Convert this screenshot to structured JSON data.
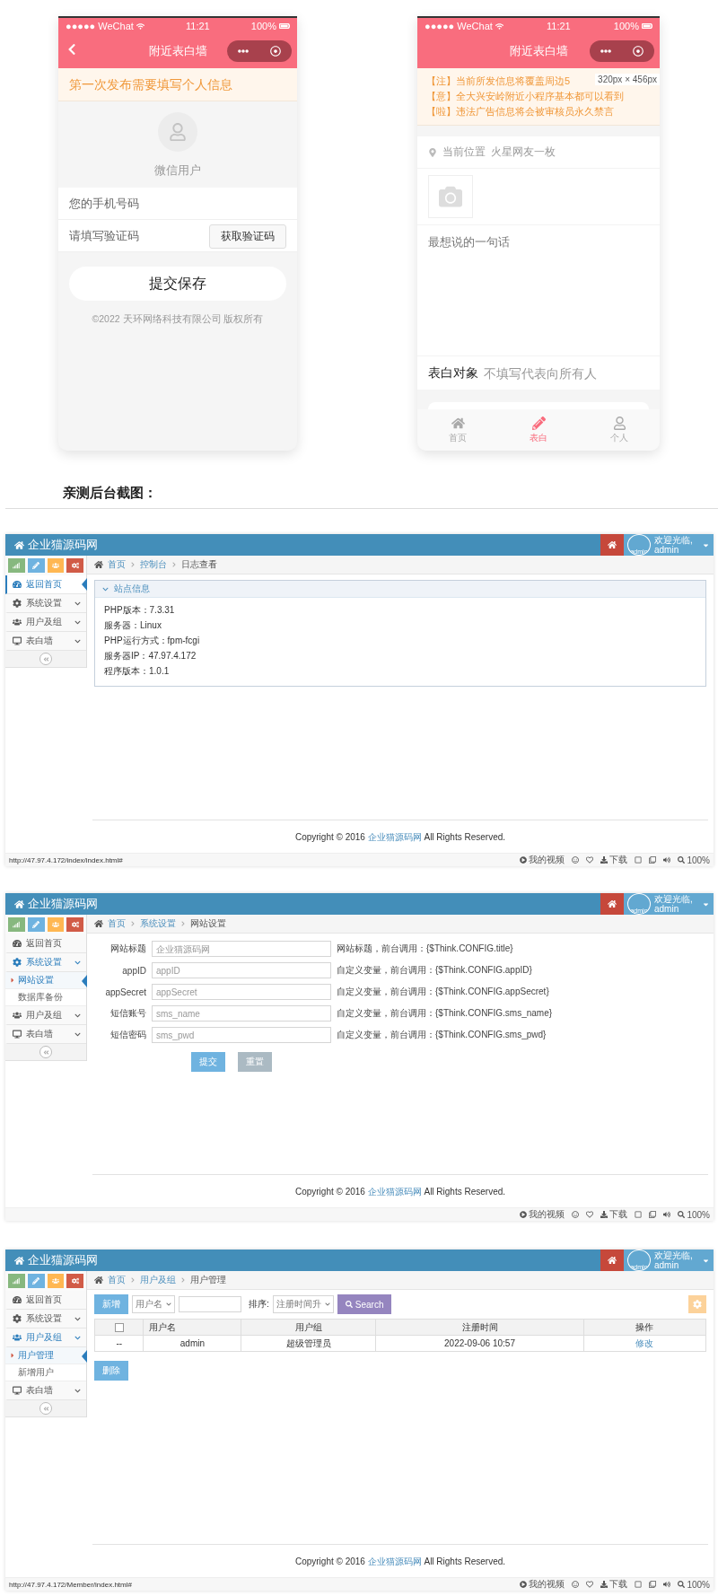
{
  "phones": [
    {
      "kind": "profile",
      "status_bar": {
        "carrier": "●●●●● WeChat",
        "time": "11:21",
        "battery": "100%"
      },
      "title": "附近表白墙",
      "notice": [
        "第一次发布需要填写个人信息"
      ],
      "nickname": "微信用户",
      "fields": [
        {
          "placeholder": "您的手机号码"
        },
        {
          "placeholder": "请填写验证码",
          "button": "获取验证码"
        }
      ],
      "submit": "提交保存",
      "copyright": "©2022 天环网络科技有限公司 版权所有"
    },
    {
      "kind": "post",
      "status_bar": {
        "carrier": "●●●●● WeChat",
        "time": "11:21",
        "battery": "100%"
      },
      "title": "附近表白墙",
      "notice": [
        "【注】当前所发信息将覆盖周边5",
        "【意】全大兴安岭附近小程序基本都可以看到",
        "【啦】违法广告信息将会被审核员永久禁言"
      ],
      "size_tooltip": "320px × 456px",
      "location": {
        "label": "当前位置",
        "value": "火星网友一枚"
      },
      "message_placeholder": "最想说的一句话",
      "target": {
        "label": "表白对象",
        "placeholder": "不填写代表向所有人"
      },
      "tabs": [
        {
          "label": "首页",
          "selected": false
        },
        {
          "label": "表白",
          "selected": true
        },
        {
          "label": "个人",
          "selected": false
        }
      ]
    }
  ],
  "heading": "亲测后台截图：",
  "admin_screens": [
    {
      "brand": "企业猫源码网",
      "user": {
        "avatar_alt": "admin",
        "greeting": "欢迎光临,",
        "name": "admin"
      },
      "breadcrumb": [
        "首页",
        "控制台",
        "日志查看"
      ],
      "sidebar": [
        {
          "kind": "link",
          "label": "返回首页",
          "selected": true
        },
        {
          "kind": "menu",
          "label": "系统设置",
          "selected": false,
          "expanded": false
        },
        {
          "kind": "menu",
          "label": "用户及组",
          "selected": false,
          "expanded": false
        },
        {
          "kind": "menu",
          "label": "表白墙",
          "selected": false,
          "expanded": false
        }
      ],
      "content": {
        "kind": "info",
        "title": "站点信息",
        "lines": [
          "PHP版本：7.3.31",
          "服务器：Linux",
          "PHP运行方式：fpm-fcgi",
          "服务器IP：47.97.4.172",
          "程序版本：1.0.1"
        ]
      },
      "footer": {
        "text": "Copyright © 2016",
        "link": "企业猫源码网",
        "suffix": "All Rights Reserved."
      },
      "status_bar": {
        "url": "http://47.97.4.172/index/index.html#",
        "items": [
          "我的视频",
          "下载",
          "100%"
        ]
      }
    },
    {
      "brand": "企业猫源码网",
      "user": {
        "avatar_alt": "admin",
        "greeting": "欢迎光临,",
        "name": "admin"
      },
      "breadcrumb": [
        "首页",
        "系统设置",
        "网站设置"
      ],
      "sidebar": [
        {
          "kind": "link",
          "label": "返回首页",
          "selected": false
        },
        {
          "kind": "menu",
          "label": "系统设置",
          "selected": false,
          "expanded": true,
          "children": [
            {
              "label": "网站设置",
              "selected": true
            },
            {
              "label": "数据库备份",
              "selected": false
            }
          ]
        },
        {
          "kind": "menu",
          "label": "用户及组",
          "selected": false,
          "expanded": false
        },
        {
          "kind": "menu",
          "label": "表白墙",
          "selected": false,
          "expanded": false
        }
      ],
      "content": {
        "kind": "form",
        "fields": [
          {
            "label": "网站标题",
            "placeholder": "企业猫源码网",
            "hint": "网站标题，前台调用：{$Think.CONFIG.title}"
          },
          {
            "label": "appID",
            "placeholder": "appID",
            "hint": "自定义变量，前台调用：{$Think.CONFIG.appID}"
          },
          {
            "label": "appSecret",
            "placeholder": "appSecret",
            "hint": "自定义变量，前台调用：{$Think.CONFIG.appSecret}"
          },
          {
            "label": "短信账号",
            "placeholder": "sms_name",
            "hint": "自定义变量，前台调用：{$Think.CONFIG.sms_name}"
          },
          {
            "label": "短信密码",
            "placeholder": "sms_pwd",
            "hint": "自定义变量，前台调用：{$Think.CONFIG.sms_pwd}"
          }
        ],
        "buttons": [
          {
            "label": "提交",
            "kind": "primary"
          },
          {
            "label": "重置",
            "kind": "secondary"
          }
        ]
      },
      "footer": {
        "text": "Copyright © 2016",
        "link": "企业猫源码网",
        "suffix": "All Rights Reserved."
      },
      "status_bar": {
        "items": [
          "我的视频",
          "下载",
          "100%"
        ]
      }
    },
    {
      "brand": "企业猫源码网",
      "user": {
        "avatar_alt": "admin",
        "greeting": "欢迎光临,",
        "name": "admin"
      },
      "breadcrumb": [
        "首页",
        "用户及组",
        "用户管理"
      ],
      "sidebar": [
        {
          "kind": "link",
          "label": "返回首页",
          "selected": false
        },
        {
          "kind": "menu",
          "label": "系统设置",
          "selected": false,
          "expanded": false
        },
        {
          "kind": "menu",
          "label": "用户及组",
          "selected": false,
          "expanded": true,
          "children": [
            {
              "label": "用户管理",
              "selected": true
            },
            {
              "label": "新增用户",
              "selected": false
            }
          ]
        },
        {
          "kind": "menu",
          "label": "表白墙",
          "selected": false,
          "expanded": false
        }
      ],
      "content": {
        "kind": "table",
        "add_button": "新增",
        "filter": "用户名",
        "sort_label": "排序:",
        "sort": "注册时间升",
        "search_button": "Search",
        "columns": [
          {
            "kind": "checkbox",
            "checked": false
          },
          {
            "kind": "text",
            "label": "用户名"
          },
          {
            "kind": "text",
            "label": "用户组"
          },
          {
            "kind": "text",
            "label": "注册时间"
          },
          {
            "kind": "text",
            "label": "操作"
          }
        ],
        "rows": [
          {
            "cells": [
              "--",
              "admin",
              "超级管理员",
              "2022-09-06 10:57",
              "修改"
            ]
          }
        ],
        "delete_button": "删除"
      },
      "footer": {
        "text": "Copyright © 2016",
        "link": "企业猫源码网",
        "suffix": "All Rights Reserved."
      },
      "status_bar": {
        "url": "http://47.97.4.172/Member/index.html#",
        "items": [
          "我的视频",
          "下载",
          "100%"
        ]
      }
    }
  ]
}
